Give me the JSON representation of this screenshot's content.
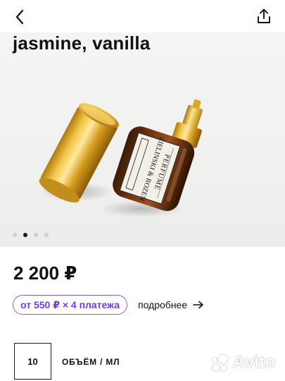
{
  "header": {
    "back_icon": "chevron-left-icon",
    "share_icon": "share-upload-icon"
  },
  "product": {
    "title": "jasmine, vanilla",
    "price": "2 200 ₽",
    "bottle_label_brand": "ZIELINSKI & ROZEN",
    "bottle_label_type": "PERFUME"
  },
  "gallery": {
    "dot_count": 4,
    "active_index": 1
  },
  "installment": {
    "pill_text": "от 550 ₽ × 4 платежа",
    "more_label": "подробнее",
    "more_icon": "arrow-right-icon",
    "accent_color": "#6a3df0"
  },
  "options": {
    "size_value": "10",
    "size_label": "ОБЪЁМ / МЛ"
  },
  "watermark": {
    "text": "Avito"
  }
}
